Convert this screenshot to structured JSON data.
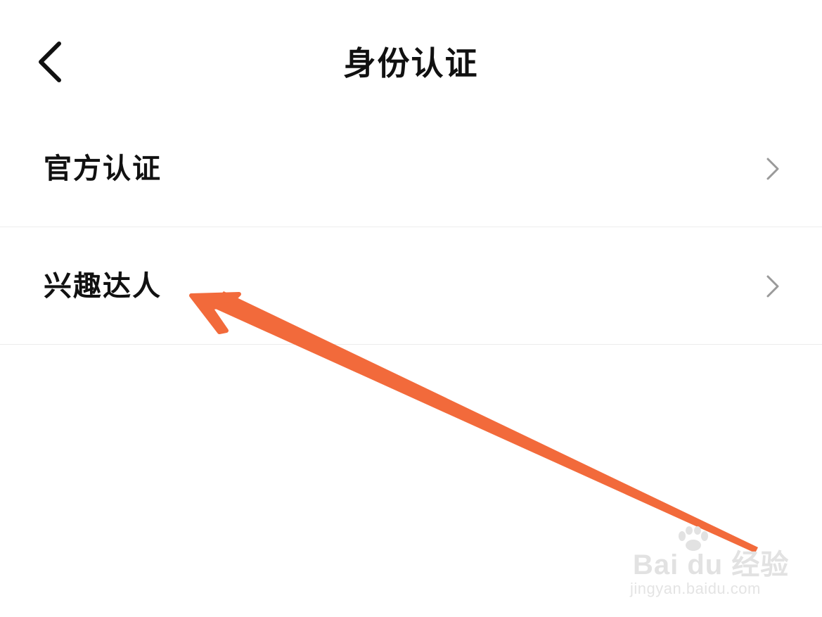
{
  "header": {
    "title": "身份认证",
    "back_icon": "chevron-left-icon"
  },
  "list": {
    "items": [
      {
        "label": "官方认证",
        "icon": "chevron-right-icon"
      },
      {
        "label": "兴趣达人",
        "icon": "chevron-right-icon"
      }
    ]
  },
  "annotation": {
    "arrow_color": "#f26a3b",
    "points_to": "兴趣达人"
  },
  "watermark": {
    "brand": "Bai du 经验",
    "url": "jingyan.baidu.com"
  },
  "colors": {
    "background": "#ffffff",
    "text": "#111111",
    "chevron": "#9a9a9a",
    "divider": "#ececec",
    "accent": "#f26a3b"
  }
}
